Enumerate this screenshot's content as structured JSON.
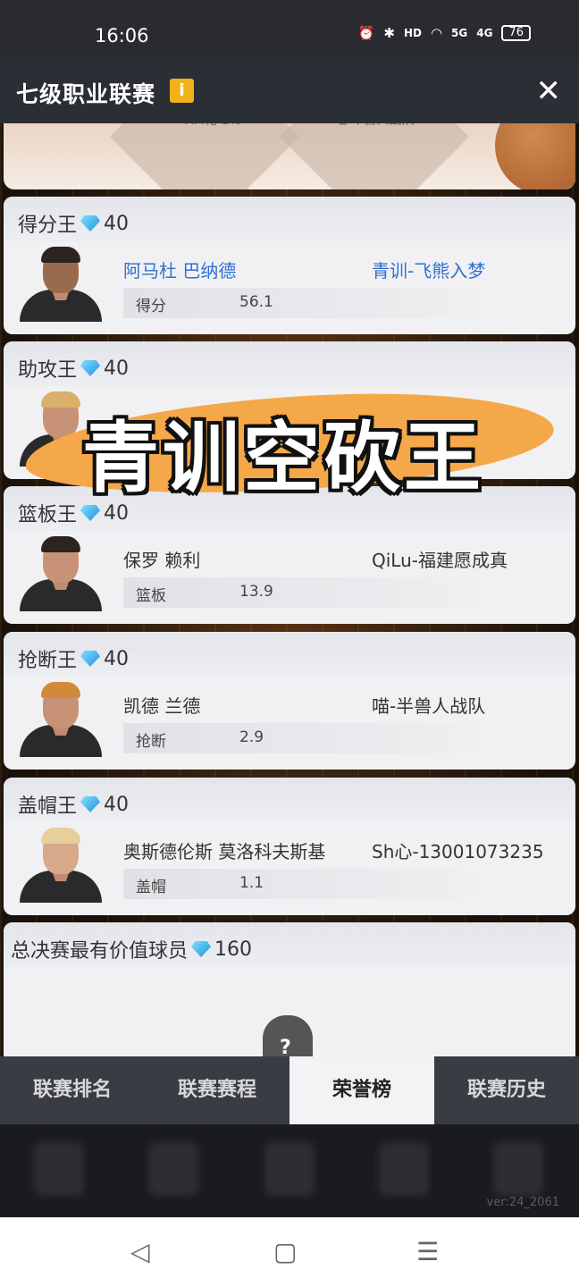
{
  "status_bar": {
    "time": "16:06",
    "hd": "HD",
    "sig1": "5G",
    "sig2": "4G",
    "battery": "76"
  },
  "header": {
    "title": "七级职业联赛",
    "info_glyph": "i",
    "close_glyph": "✕"
  },
  "top_strip": {
    "left_tag": "AM花-Dio",
    "right_tag": "喵-半兽人战队"
  },
  "awards": [
    {
      "title": "得分王",
      "reward": "40",
      "player": "阿马杜 巴纳德",
      "team": "青训-飞熊入梦",
      "stat_label": "得分",
      "stat_value": "56.1"
    },
    {
      "title": "助攻王",
      "reward": "40",
      "player": "",
      "team": "",
      "stat_label": "",
      "stat_value": ""
    },
    {
      "title": "篮板王",
      "reward": "40",
      "player": "保罗 赖利",
      "team": "QiLu-福建愿成真",
      "stat_label": "篮板",
      "stat_value": "13.9"
    },
    {
      "title": "抢断王",
      "reward": "40",
      "player": "凯德 兰德",
      "team": "喵-半兽人战队",
      "stat_label": "抢断",
      "stat_value": "2.9"
    },
    {
      "title": "盖帽王",
      "reward": "40",
      "player": "奥斯德伦斯 莫洛科夫斯基",
      "team": "Sh心-13001073235",
      "stat_label": "盖帽",
      "stat_value": "1.1"
    },
    {
      "title": "总决赛最有价值球员",
      "reward": "160"
    }
  ],
  "mvp_placeholder": "?",
  "overlay_banner": "青训空砍王",
  "tabs": [
    {
      "label": "联赛排名"
    },
    {
      "label": "联赛赛程"
    },
    {
      "label": "荣誉榜"
    },
    {
      "label": "联赛历史"
    }
  ],
  "version": "ver:24_2061",
  "nav": {
    "back": "◁",
    "home": "▢",
    "menu": "☰"
  },
  "colors": {
    "accent_blue": "#2f6fd0",
    "banner_orange": "#f5a84a",
    "info_badge": "#f3b21c"
  }
}
